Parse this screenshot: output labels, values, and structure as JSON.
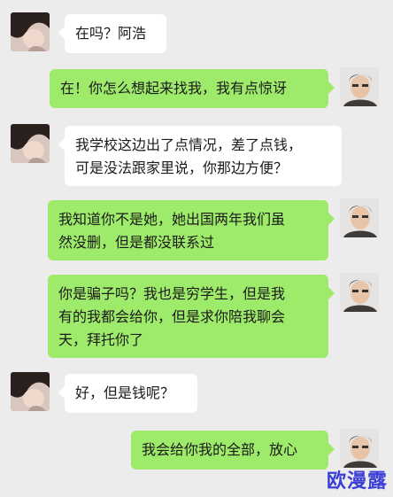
{
  "chat": {
    "messages": [
      {
        "side": "left",
        "text": "在吗？阿浩"
      },
      {
        "side": "right",
        "text": "在！你怎么想起来找我，我有点惊讶"
      },
      {
        "side": "left",
        "text": "我学校这边出了点情况，差了点钱，\n可是没法跟家里说，你那边方便？"
      },
      {
        "side": "right",
        "text": "我知道你不是她，她出国两年我们虽\n然没删，但是都没联系过"
      },
      {
        "side": "right",
        "text": "你是骗子吗？我也是穷学生，但是我\n有的我都会给你，但是求你陪我聊会\n天，拜托你了"
      },
      {
        "side": "left",
        "text": "好，但是钱呢？"
      },
      {
        "side": "right",
        "text": "我会给你我的全部，放心"
      }
    ]
  },
  "avatars": {
    "left": "woman-avatar-icon",
    "right": "man-avatar-icon"
  },
  "colors": {
    "background": "#ececec",
    "bubble_left": "#ffffff",
    "bubble_right": "#9eea6a",
    "watermark": "#3b3fd6"
  },
  "watermark": {
    "text": "欧漫露"
  }
}
